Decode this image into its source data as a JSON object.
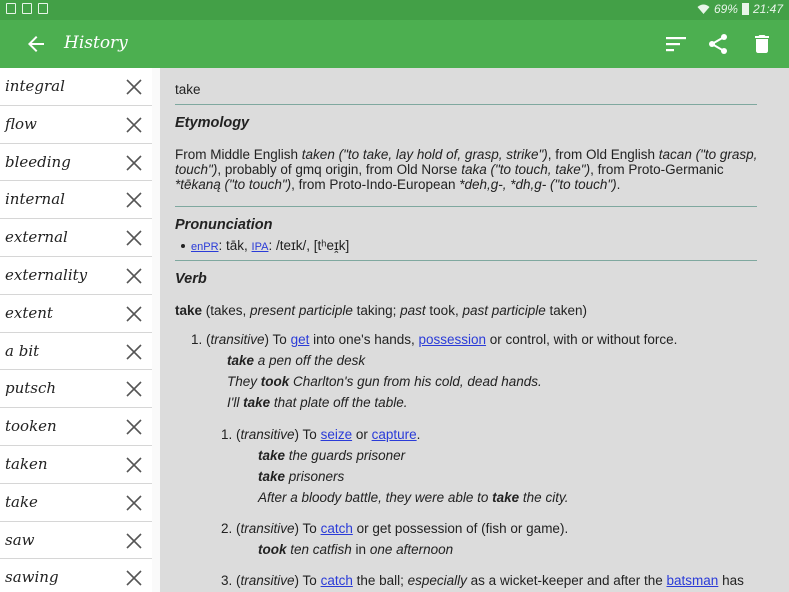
{
  "status": {
    "battery": "69%",
    "time": "21:47"
  },
  "appbar": {
    "title": "History"
  },
  "history": [
    "integral",
    "flow",
    "bleeding",
    "internal",
    "external",
    "externality",
    "extent",
    "a bit",
    "putsch",
    "tooken",
    "taken",
    "take",
    "saw",
    "sawing"
  ],
  "entry": {
    "headword": "take",
    "etymology_heading": "Etymology",
    "ety": {
      "l1a": "From Middle English ",
      "l1b": "taken (\"to take, lay hold of, grasp, strike\")",
      "l1c": ", from Old English ",
      "l1d": "tacan (\"to grasp,",
      "l2a": "touch\")",
      "l2b": ", probably of gmq origin, from Old Norse ",
      "l2c": "taka (\"to touch, take\")",
      "l2d": ", from Proto-Germanic",
      "l3a": "*tēkaną (\"to touch\")",
      "l3b": ", from Proto-Indo-European ",
      "l3c": "*deh,g-, *dh,g- (\"to touch\")",
      "l3d": "."
    },
    "pron_heading": "Pronunciation",
    "pron": {
      "enpr_label": "enPR",
      "enpr_val": ": tāk, ",
      "ipa_label": "IPA",
      "ipa_val": ": /teɪk/, [tʰeɪ̯k]"
    },
    "verb_heading": "Verb",
    "inflection": {
      "w1": "take",
      "w2": " (takes, ",
      "w3": "present participle",
      "w4": " taking; ",
      "w5": "past",
      "w6": " took, ",
      "w7": "past participle",
      "w8": " taken)"
    },
    "s1": {
      "num": "1. (",
      "tag": "transitive",
      "pre": ") To ",
      "l1": "get",
      "mid": " into one's hands, ",
      "l2": "possession",
      "post": " or control, with or without force.",
      "ex1a": "take",
      "ex1b": " a pen off the desk",
      "ex2a": "They ",
      "ex2b": "took",
      "ex2c": " Charlton's gun from his cold, dead hands.",
      "ex3a": "I'll ",
      "ex3b": "take",
      "ex3c": " that plate off the table.",
      "sub1": {
        "num": "1. (",
        "tag": "transitive",
        "pre": ") To ",
        "l1": "seize",
        "mid": " or ",
        "l2": "capture",
        "post": ".",
        "ex1a": "take",
        "ex1b": " the guards prisoner",
        "ex2a": "take",
        "ex2b": " prisoners",
        "ex3a": "After a bloody battle, they were able to ",
        "ex3b": "take",
        "ex3c": " the city."
      },
      "sub2": {
        "num": "2. (",
        "tag": "transitive",
        "pre": ") To ",
        "l1": "catch",
        "post": " or get possession of (fish or game).",
        "ex1a": "took",
        "ex1b": " ten catfish ",
        "ex1c": "in",
        "ex1d": " one afternoon"
      },
      "sub3": {
        "num": "3. (",
        "tag": "transitive",
        "pre": ") To ",
        "l1": "catch",
        "mid": " the ball; ",
        "it": "especially",
        "mid2": " as a wicket-keeper and after the ",
        "l2": "batsman",
        "post": " has"
      }
    }
  }
}
